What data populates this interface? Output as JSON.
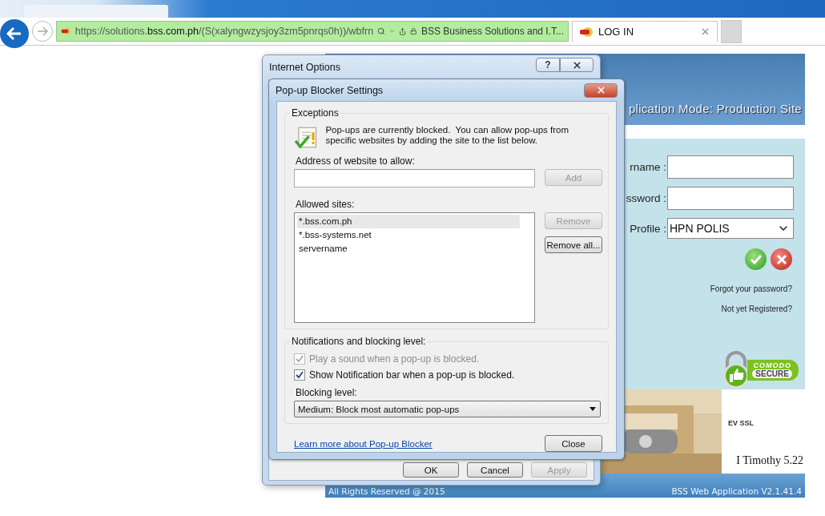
{
  "address_bar": {
    "url": "https://solutions.**bss.com.ph**/(S(xalyngwzysjoy3zm5pnrqs0h))/wbfrn",
    "site_title": "BSS Business Solutions and I.T..."
  },
  "tabs": [
    {
      "label": "LOG IN",
      "selected": true
    }
  ],
  "page": {
    "mode_banner": "plication Mode: Production Site",
    "login_fields": [
      {
        "label": "rname :",
        "kind": "text"
      },
      {
        "label": "ssword :",
        "kind": "text"
      },
      {
        "label": "Profile :",
        "kind": "select",
        "value": "HPN POLIS"
      }
    ],
    "links": [
      "Forgot your password?",
      "Not yet Registered?"
    ],
    "ssl_badge": {
      "brand": "COMODO",
      "caption": "SECURE",
      "label": "EV SSL"
    },
    "verse": "I Timothy 5.22",
    "footer_left": "All Rights Reserved @ 2015",
    "footer_right": "BSS Web Application V2.1.41.4"
  },
  "internet_options": {
    "title": "Internet Options",
    "help_button": "?",
    "buttons": [
      {
        "label": "OK",
        "disabled": false
      },
      {
        "label": "Cancel",
        "disabled": false
      },
      {
        "label": "Apply",
        "disabled": true
      }
    ]
  },
  "popup_blocker": {
    "title": "Pop-up Blocker Settings",
    "exceptions": {
      "legend": "Exceptions",
      "info": "Pop-ups are currently blocked.  You can allow pop-ups from specific websites by adding the site to the list below.",
      "address_label": "Address of website to allow:",
      "add_button": {
        "label": "Add",
        "disabled": true
      },
      "allowed_label": "Allowed sites:",
      "sites": [
        {
          "label": "*.bss.com.ph",
          "selected": true
        },
        {
          "label": "*.bss-systems.net",
          "selected": false
        },
        {
          "label": "servername",
          "selected": false
        }
      ],
      "remove_button": {
        "label": "Remove",
        "disabled": true
      },
      "remove_all_button": {
        "label": "Remove all...",
        "disabled": false
      }
    },
    "notifications": {
      "legend": "Notifications and blocking level:",
      "options": [
        {
          "label": "Play a sound when a pop-up is blocked.",
          "checked": true,
          "disabled": true
        },
        {
          "label": "Show Notification bar when a pop-up is blocked.",
          "checked": true,
          "disabled": false
        }
      ],
      "level_label": "Blocking level:",
      "level": "Medium: Block most automatic pop-ups"
    },
    "learn_more_link": "Learn more about Pop-up Blocker",
    "close_button": "Close"
  }
}
